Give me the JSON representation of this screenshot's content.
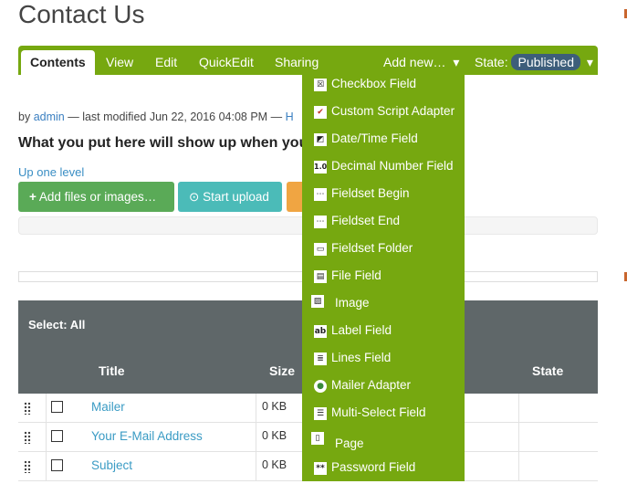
{
  "page": {
    "title": "Contact Us"
  },
  "toolbar": {
    "tabs": [
      "Contents",
      "View",
      "Edit",
      "QuickEdit",
      "Sharing"
    ],
    "add_new": "Add new…",
    "add_new_caret": "▾",
    "state_label": "State:",
    "state_value": "Published",
    "state_caret": "▾"
  },
  "byline": {
    "prefix": "by",
    "author": "admin",
    "modified": "— last modified Jun 22, 2016 04:08 PM —",
    "tail": "H"
  },
  "headline": "What you put here will show up when you",
  "up_level": "Up one level",
  "buttons": {
    "add_files": "Add files or images…",
    "start_upload": "Start upload",
    "plus_icon": "+",
    "upload_icon": "⊙"
  },
  "table": {
    "select_all": "Select: All",
    "headers": [
      "Title",
      "Size",
      "State"
    ],
    "rows": [
      {
        "title": "Mailer",
        "size": "0 KB"
      },
      {
        "title": "Your E-Mail Address",
        "size": "0 KB"
      },
      {
        "title": "Subject",
        "size": "0 KB"
      }
    ]
  },
  "add_new_menu": {
    "items": [
      {
        "label": "Checkbox Field",
        "icon": "checkbox-field-icon",
        "glyph": "☒"
      },
      {
        "label": "Custom Script Adapter",
        "icon": "custom-script-adapter-icon",
        "glyph": "✔"
      },
      {
        "label": "Date/Time Field",
        "icon": "date-time-field-icon",
        "glyph": "◩"
      },
      {
        "label": "Decimal Number Field",
        "icon": "decimal-number-field-icon",
        "glyph": "1.0"
      },
      {
        "label": "Fieldset Begin",
        "icon": "fieldset-begin-icon",
        "glyph": "⋯"
      },
      {
        "label": "Fieldset End",
        "icon": "fieldset-end-icon",
        "glyph": "⋯"
      },
      {
        "label": "Fieldset Folder",
        "icon": "fieldset-folder-icon",
        "glyph": "▭"
      },
      {
        "label": "File Field",
        "icon": "file-field-icon",
        "glyph": "▤"
      },
      {
        "label": "Image",
        "icon": "image-icon",
        "glyph": "▨"
      },
      {
        "label": "Label Field",
        "icon": "label-field-icon",
        "glyph": "ab"
      },
      {
        "label": "Lines Field",
        "icon": "lines-field-icon",
        "glyph": "≣"
      },
      {
        "label": "Mailer Adapter",
        "icon": "mailer-adapter-icon",
        "glyph": "●"
      },
      {
        "label": "Multi-Select Field",
        "icon": "multi-select-field-icon",
        "glyph": "☰"
      },
      {
        "label": "Page",
        "icon": "page-icon",
        "glyph": "▯"
      },
      {
        "label": "Password Field",
        "icon": "password-field-icon",
        "glyph": "**"
      }
    ]
  },
  "colors": {
    "accent_green": "#76a810",
    "state_badge": "#3d5e7a",
    "table_header": "#5f6769",
    "button_green": "#5aaa57",
    "button_teal": "#4bbbb8",
    "button_orange": "#f0a542",
    "link_blue": "#3a9bc4"
  }
}
